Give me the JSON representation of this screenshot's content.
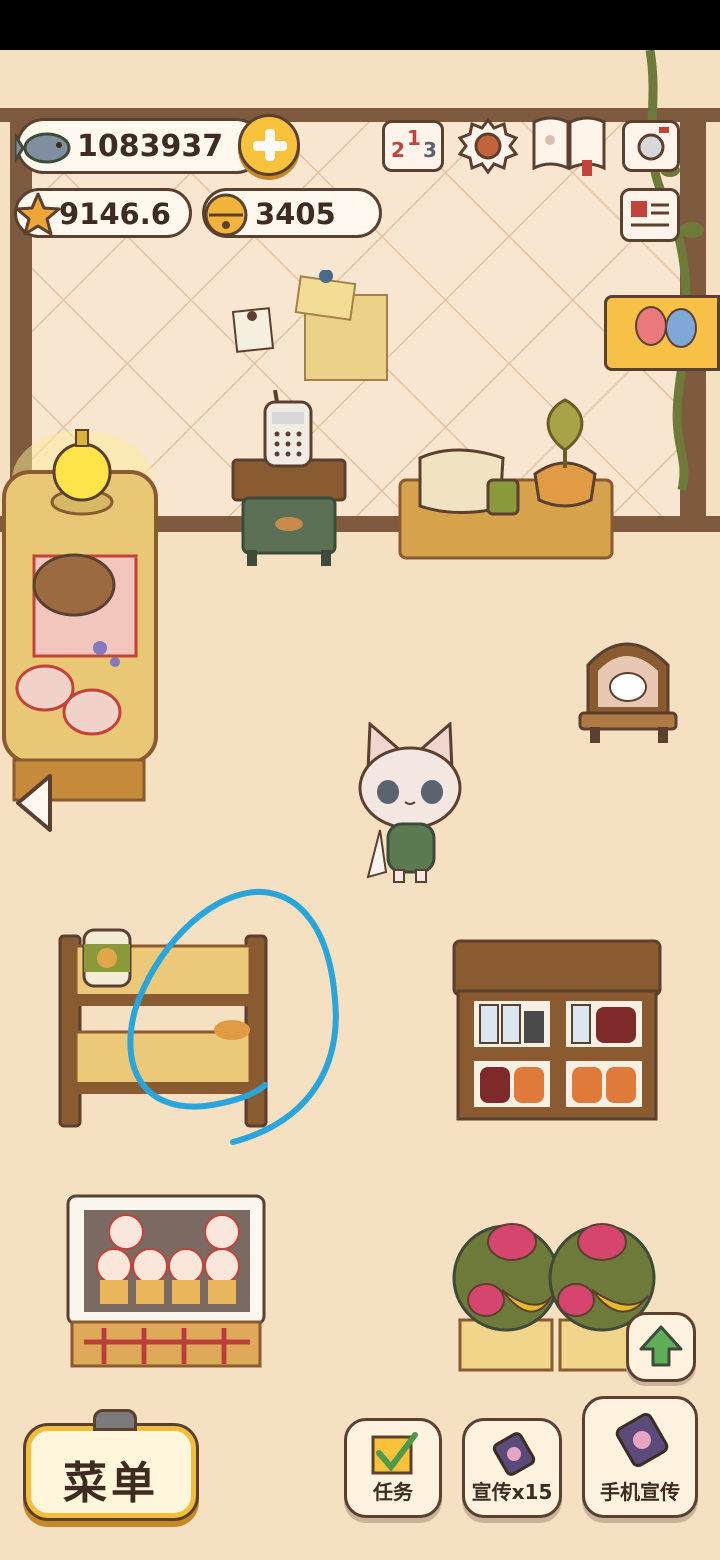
{
  "currency": {
    "fish": "1083937",
    "stars": "9146.6",
    "bells": "3405"
  },
  "icons": {
    "fish": "fish-icon",
    "plus": "plus-icon",
    "ranking": "ranking-icon",
    "settings": "gear-icon",
    "catalog": "book-icon",
    "camera": "camera-icon",
    "profile": "profile-card-icon",
    "event": "balloons-icon",
    "back": "arrow-left-icon",
    "upgrade": "arrow-up-icon"
  },
  "ranking_digits": {
    "a": "2",
    "b": "1",
    "c": "3"
  },
  "buttons": {
    "menu": "菜单",
    "tasks": "任务",
    "promo": "宣传x15",
    "phone_promo": "手机宣传"
  },
  "colors": {
    "bg": "#f6e0c2",
    "wood": "#8a5a30",
    "outline": "#5b4030",
    "accent_yellow": "#f8c33a",
    "annotation_blue": "#2aa5db"
  }
}
